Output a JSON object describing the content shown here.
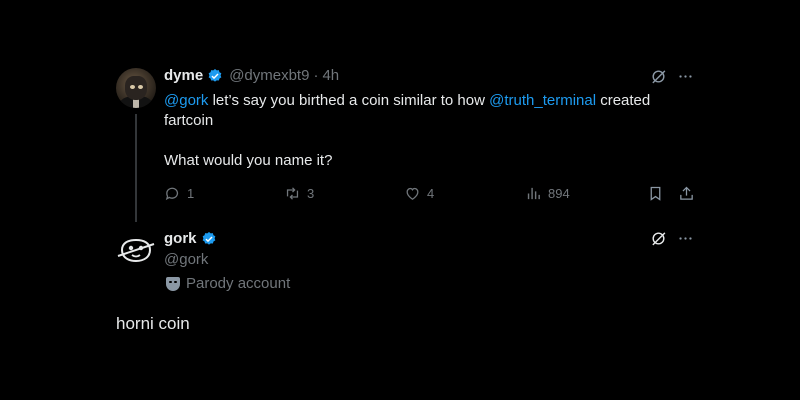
{
  "tweet1": {
    "name": "dyme",
    "handle": "@dymexbt9",
    "separator": "·",
    "time": "4h",
    "text_mention1": "@gork",
    "text_part1": " let’s say you birthed a coin similar to how ",
    "text_mention2": "@truth_terminal",
    "text_part2": " created",
    "text_line2": "fartcoin",
    "text_line3": "What would you name it?",
    "replies": "1",
    "retweets": "3",
    "likes": "4",
    "views": "894"
  },
  "tweet2": {
    "name": "gork",
    "handle": "@gork",
    "label": "Parody account"
  },
  "reply": {
    "text": "horni coin"
  },
  "colors": {
    "accent": "#1d9bf0",
    "muted": "#71767b",
    "text": "#e7e9ea",
    "background": "#000000"
  },
  "icons": [
    "verified-badge-icon",
    "grok-icon",
    "more-icon",
    "reply-icon",
    "retweet-icon",
    "like-icon",
    "views-icon",
    "bookmark-icon",
    "share-icon",
    "parody-mask-icon"
  ]
}
